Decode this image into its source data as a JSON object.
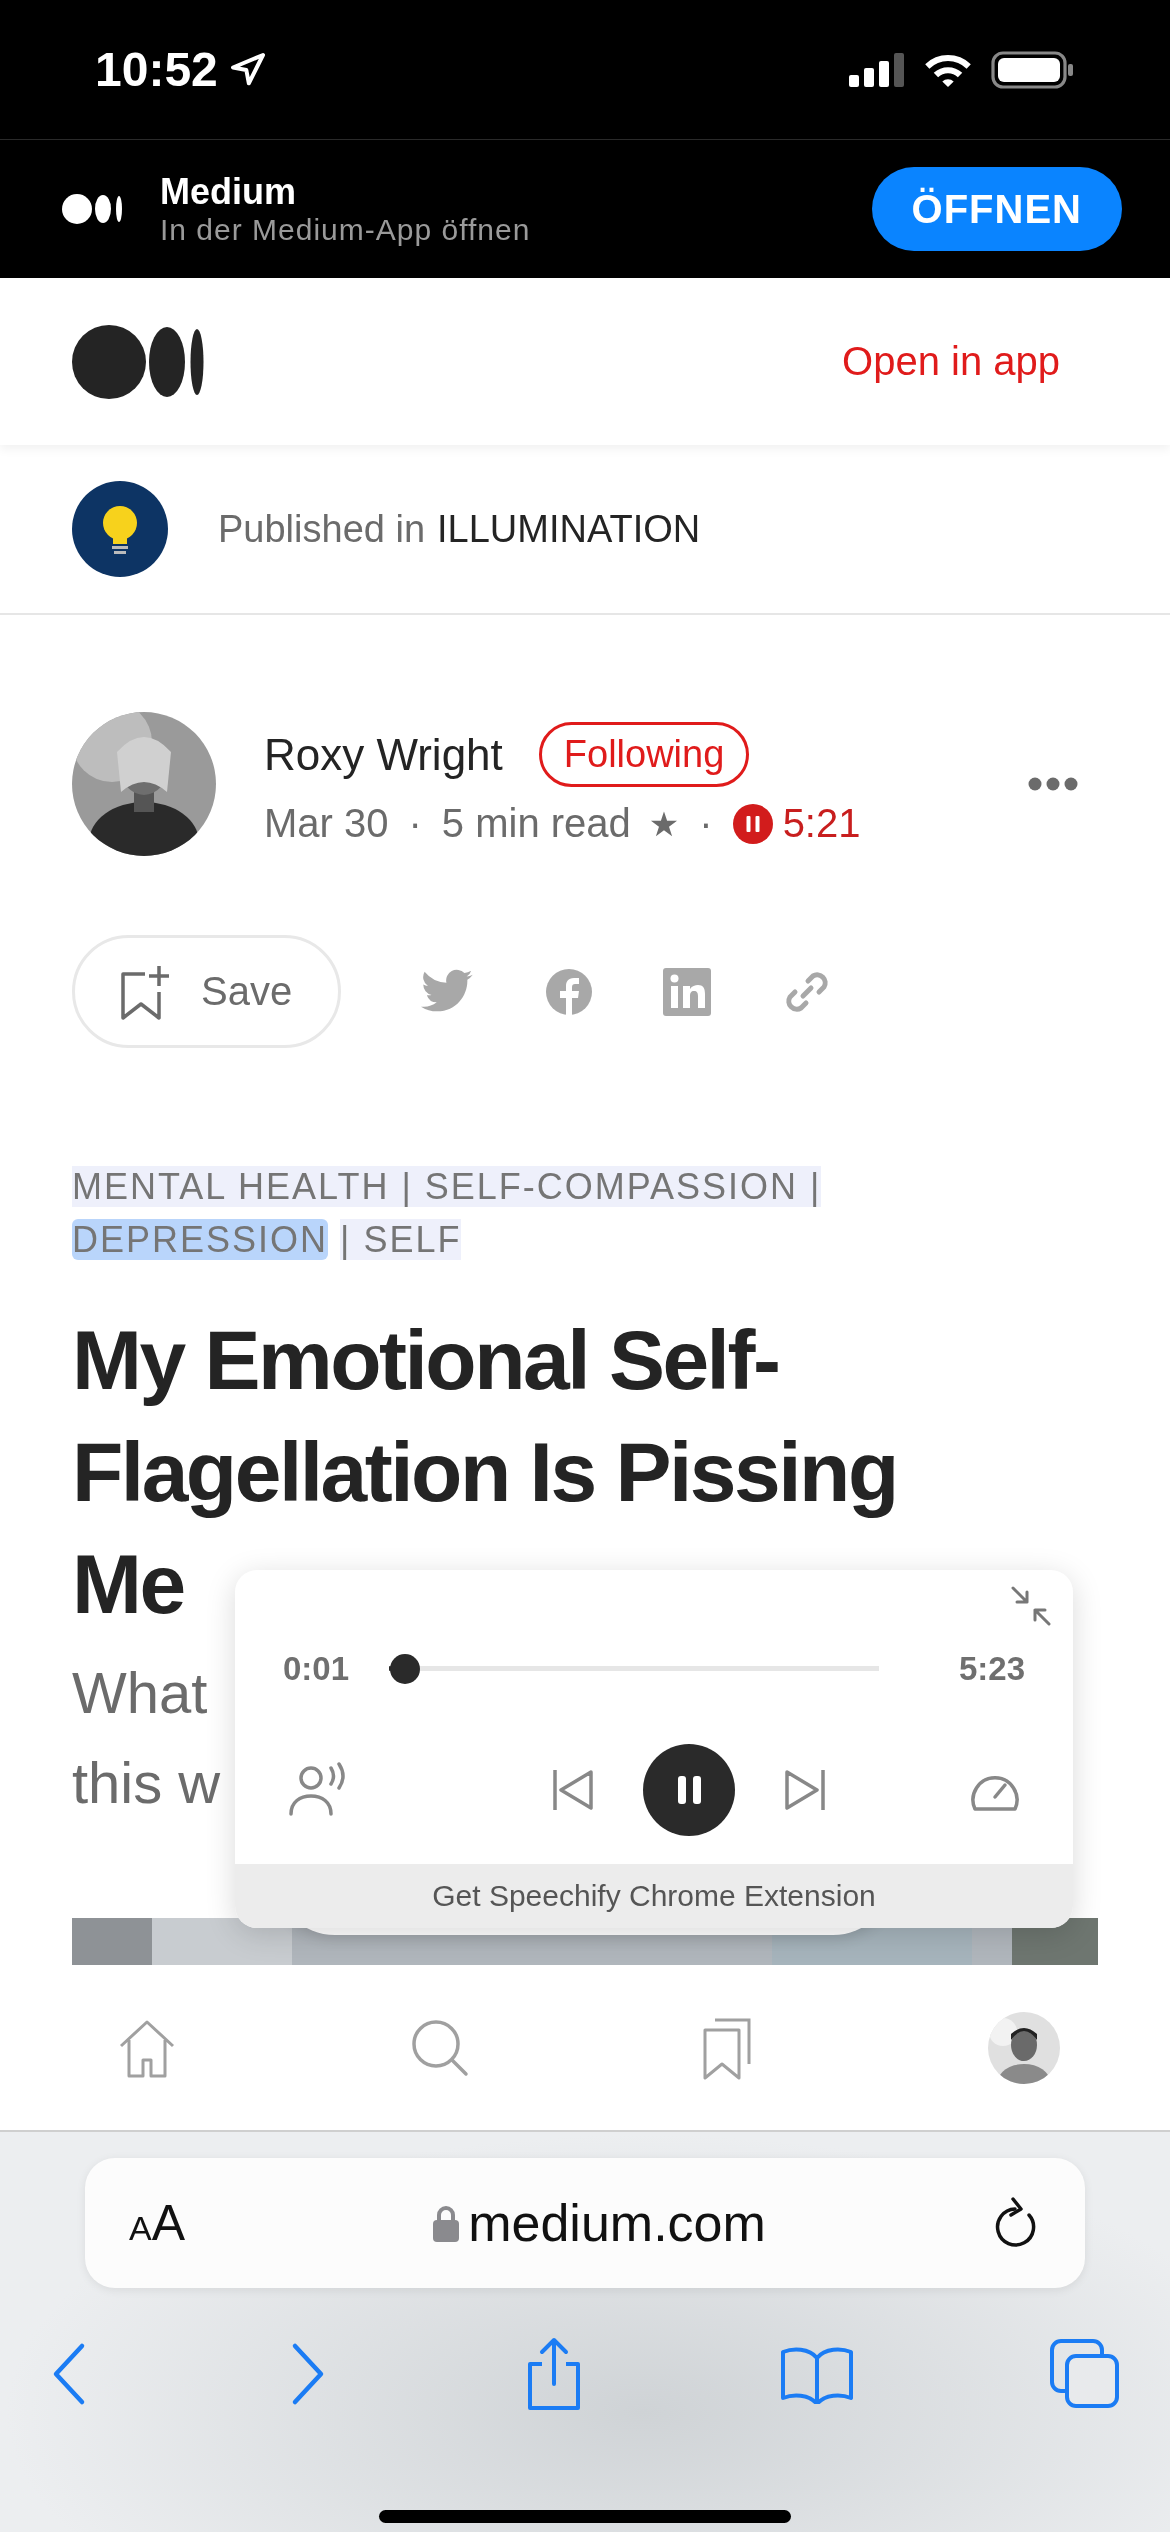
{
  "status_bar": {
    "time": "10:52"
  },
  "app_banner": {
    "title": "Medium",
    "subtitle": "In der Medium-App öffnen",
    "button": "ÖFFNEN"
  },
  "header": {
    "link": "Open in app"
  },
  "publication": {
    "prefix": "Published in",
    "name": "ILLUMINATION"
  },
  "author": {
    "name": "Roxy Wright",
    "follow_button": "Following",
    "date": "Mar 30",
    "separators": [
      "·",
      "·"
    ],
    "read_time": "5 min read",
    "star": "★",
    "audio_time": "5:21"
  },
  "actions": {
    "save": "Save"
  },
  "tags": [
    {
      "text": "MENTAL HEALTH | SELF-COMPASSION |",
      "selected": false
    },
    {
      "text": "DEPRESSION",
      "selected": true
    },
    {
      "text": " | SELF",
      "selected": false
    }
  ],
  "article": {
    "title": "My Emotional Self-Flagellation Is Pissing Me",
    "subtitle": "What this w"
  },
  "player": {
    "elapsed": "0:01",
    "duration": "5:23",
    "level": 0.003,
    "playing": true,
    "footer": "Get Speechify Chrome Extension"
  },
  "browser": {
    "text_size_button": "AA",
    "url": "medium.com"
  }
}
